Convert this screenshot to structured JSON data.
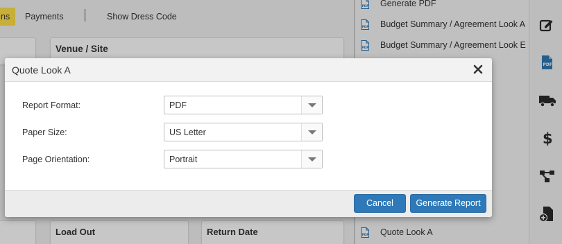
{
  "background": {
    "tabs": {
      "active_partial": "ns",
      "payments": "Payments",
      "dress_code": "Show Dress Code"
    },
    "cards": {
      "venue_title": "Venue / Site",
      "load_out_title": "Load Out",
      "return_date_title": "Return Date"
    },
    "documents": [
      {
        "label": "Generate PDF",
        "icon": "pdf-file-icon"
      },
      {
        "label": "Budget Summary / Agreement Look A",
        "icon": "pdf-file-icon"
      },
      {
        "label": "Budget Summary / Agreement Look E",
        "icon": "pdf-file-icon"
      },
      {
        "label": "Quote Look A",
        "icon": "pdf-file-icon"
      }
    ],
    "rail_icons": [
      "edit-icon",
      "pdf-icon",
      "truck-icon",
      "dollar-icon",
      "workflow-icon",
      "add-document-icon"
    ],
    "colors": {
      "accent_yellow": "#ffe14a",
      "icon_blue": "#2f79b8",
      "icon_dark": "#2b2b2b"
    }
  },
  "modal": {
    "title": "Quote Look A",
    "close_icon": "close-icon",
    "fields": [
      {
        "label": "Report Format:",
        "value": "PDF"
      },
      {
        "label": "Paper Size:",
        "value": "US Letter"
      },
      {
        "label": "Page Orientation:",
        "value": "Portrait"
      }
    ],
    "buttons": {
      "cancel": "Cancel",
      "generate": "Generate Report"
    },
    "colors": {
      "button": "#2f79b8"
    }
  }
}
